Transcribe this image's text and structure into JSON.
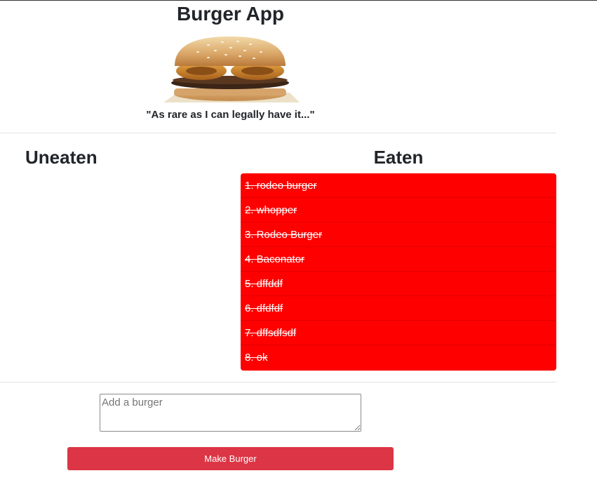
{
  "header": {
    "title": "Burger App",
    "tagline": "\"As rare as I can legally have it...\"",
    "image_icon": "burger-image"
  },
  "columns": {
    "uneaten_title": "Uneaten",
    "eaten_title": "Eaten"
  },
  "uneaten_items": [],
  "eaten_items": [
    "1. rodeo burger",
    "2. whopper",
    "3. Rodeo Burger",
    "4. Baconator",
    "5. dffddf",
    "6. dfdfdf",
    "7. dffsdfsdf",
    "8. ok"
  ],
  "form": {
    "input_placeholder": "Add a burger",
    "input_value": "",
    "submit_label": "Make Burger"
  },
  "colors": {
    "eaten_bg": "#ff0000",
    "button_bg": "#dc3545",
    "text": "#212529"
  }
}
